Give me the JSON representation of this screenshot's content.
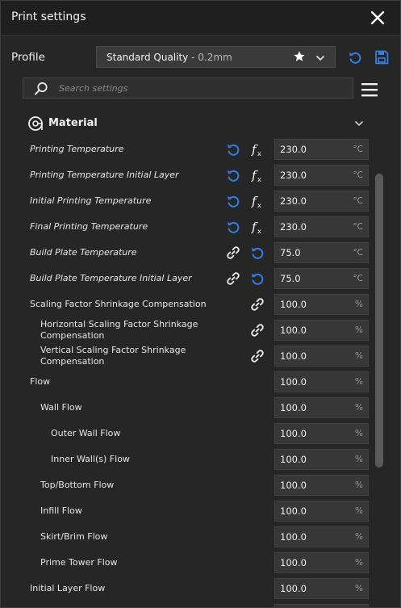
{
  "window": {
    "title": "Print settings"
  },
  "profile": {
    "label": "Profile",
    "name": "Standard Quality",
    "sub": " - 0.2mm"
  },
  "search": {
    "placeholder": "Search settings"
  },
  "section": {
    "title": "Material"
  },
  "icons": {
    "close": "close-icon",
    "reset": "reset-icon",
    "save": "save-icon",
    "star": "star-icon",
    "chevron": "chevron-down-icon",
    "search": "search-icon",
    "menu": "hamburger-menu-icon",
    "material": "spool-icon",
    "function": "function-icon",
    "link": "link-icon"
  },
  "colors": {
    "accent": "#2f7fe4",
    "background": "#262626",
    "field": "#373737"
  },
  "settings": [
    {
      "label": "Printing Temperature",
      "value": "230.0",
      "unit": "°C",
      "indent": 0,
      "italic": true,
      "icons": [
        "reset",
        "function"
      ]
    },
    {
      "label": "Printing Temperature Initial Layer",
      "value": "230.0",
      "unit": "°C",
      "indent": 0,
      "italic": true,
      "icons": [
        "reset",
        "function"
      ]
    },
    {
      "label": "Initial Printing Temperature",
      "value": "230.0",
      "unit": "°C",
      "indent": 0,
      "italic": true,
      "icons": [
        "reset",
        "function"
      ]
    },
    {
      "label": "Final Printing Temperature",
      "value": "230.0",
      "unit": "°C",
      "indent": 0,
      "italic": true,
      "icons": [
        "reset",
        "function"
      ]
    },
    {
      "label": "Build Plate Temperature",
      "value": "75.0",
      "unit": "°C",
      "indent": 0,
      "italic": true,
      "icons": [
        "link",
        "reset"
      ]
    },
    {
      "label": "Build Plate Temperature Initial Layer",
      "value": "75.0",
      "unit": "°C",
      "indent": 0,
      "italic": true,
      "icons": [
        "link",
        "reset"
      ]
    },
    {
      "label": "Scaling Factor Shrinkage Compensation",
      "value": "100.0",
      "unit": "%",
      "indent": 0,
      "italic": false,
      "icons": [
        "link"
      ]
    },
    {
      "label": "Horizontal Scaling Factor Shrinkage Compensation",
      "value": "100.0",
      "unit": "%",
      "indent": 1,
      "italic": false,
      "icons": [
        "link"
      ]
    },
    {
      "label": "Vertical Scaling Factor Shrinkage Compensation",
      "value": "100.0",
      "unit": "%",
      "indent": 1,
      "italic": false,
      "icons": [
        "link"
      ]
    },
    {
      "label": "Flow",
      "value": "100.0",
      "unit": "%",
      "indent": 0,
      "italic": false,
      "icons": []
    },
    {
      "label": "Wall Flow",
      "value": "100.0",
      "unit": "%",
      "indent": 1,
      "italic": false,
      "icons": []
    },
    {
      "label": "Outer Wall Flow",
      "value": "100.0",
      "unit": "%",
      "indent": 2,
      "italic": false,
      "icons": []
    },
    {
      "label": "Inner Wall(s) Flow",
      "value": "100.0",
      "unit": "%",
      "indent": 2,
      "italic": false,
      "icons": []
    },
    {
      "label": "Top/Bottom Flow",
      "value": "100.0",
      "unit": "%",
      "indent": 1,
      "italic": false,
      "icons": []
    },
    {
      "label": "Infill Flow",
      "value": "100.0",
      "unit": "%",
      "indent": 1,
      "italic": false,
      "icons": []
    },
    {
      "label": "Skirt/Brim Flow",
      "value": "100.0",
      "unit": "%",
      "indent": 1,
      "italic": false,
      "icons": []
    },
    {
      "label": "Prime Tower Flow",
      "value": "100.0",
      "unit": "%",
      "indent": 1,
      "italic": false,
      "icons": []
    },
    {
      "label": "Initial Layer Flow",
      "value": "100.0",
      "unit": "%",
      "indent": 0,
      "italic": false,
      "icons": []
    },
    {
      "label": "",
      "value": "",
      "unit": "",
      "indent": 0,
      "italic": false,
      "icons": []
    }
  ]
}
